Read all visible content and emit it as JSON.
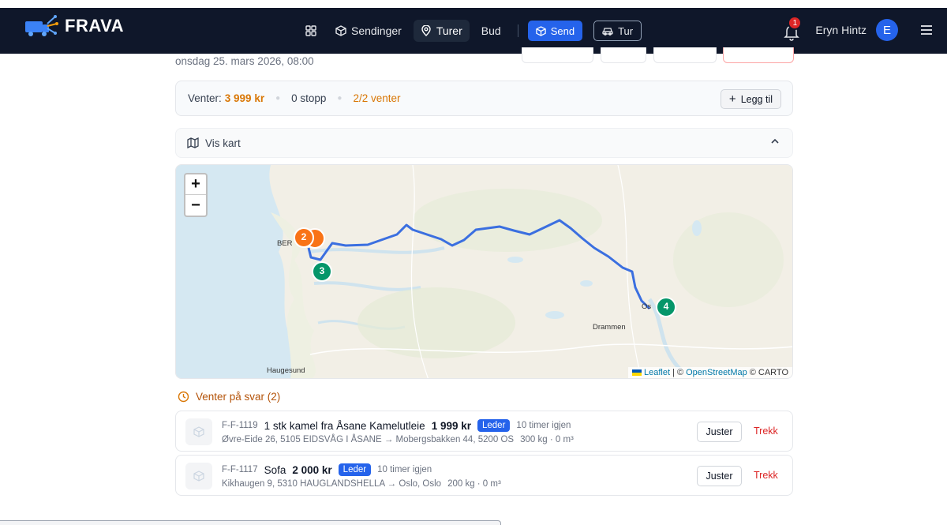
{
  "app": {
    "brand": "FRAVA"
  },
  "nav": {
    "items": [
      {
        "label": "",
        "icon": "grid-icon"
      },
      {
        "label": "Sendinger",
        "icon": "box-icon"
      },
      {
        "label": "Turer",
        "icon": "map-pin-icon",
        "active": true
      },
      {
        "label": "Bud"
      }
    ],
    "send_label": "Send",
    "tur_label": "Tur"
  },
  "user": {
    "notifications": "1",
    "name": "Eryn Hintz",
    "initial": "E"
  },
  "trip": {
    "datetime": "onsdag 25. mars 2026, 08:00"
  },
  "summary": {
    "waiting_label": "Venter:",
    "waiting_amount": "3 999 kr",
    "stops": "0 stopp",
    "pending": "2/2 venter",
    "add_label": "Legg til"
  },
  "map_toggle": {
    "label": "Vis kart"
  },
  "map": {
    "labels": {
      "bergen": "BER",
      "drammen": "Drammen",
      "haugesund": "Haugesund",
      "oslo": "Os"
    },
    "markers": [
      "2",
      "3",
      "4"
    ],
    "attribution": {
      "leaflet": "Leaflet",
      "sep": "| ©",
      "osm": "OpenStreetMap",
      "carto": "© CARTO"
    }
  },
  "waiting": {
    "heading": "Venter på svar (2)",
    "bids": [
      {
        "id": "F-F-1119",
        "title": "1 stk kamel fra Åsane Kamelutleie",
        "price": "1 999 kr",
        "badge": "Leder",
        "time_left": "10 timer igjen",
        "route": "Øvre-Eide 26, 5105 EIDSVÅG I ÅSANE → Mobergsbakken 44, 5200 OS",
        "specs": "300 kg · 0 m³",
        "adjust_label": "Juster",
        "withdraw_label": "Trekk"
      },
      {
        "id": "F-F-1117",
        "title": "Sofa",
        "price": "2 000 kr",
        "badge": "Leder",
        "time_left": "10 timer igjen",
        "route": "Kikhaugen 9, 5310 HAUGLANDSHELLA → Oslo, Oslo",
        "specs": "200 kg · 0 m³",
        "adjust_label": "Juster",
        "withdraw_label": "Trekk"
      }
    ]
  },
  "colors": {
    "nav_bg": "#0f172a",
    "accent": "#2563eb",
    "orange": "#d97706",
    "marker_orange": "#f97316",
    "marker_green": "#059669",
    "route": "#3b6fe0",
    "danger": "#dc2626"
  }
}
